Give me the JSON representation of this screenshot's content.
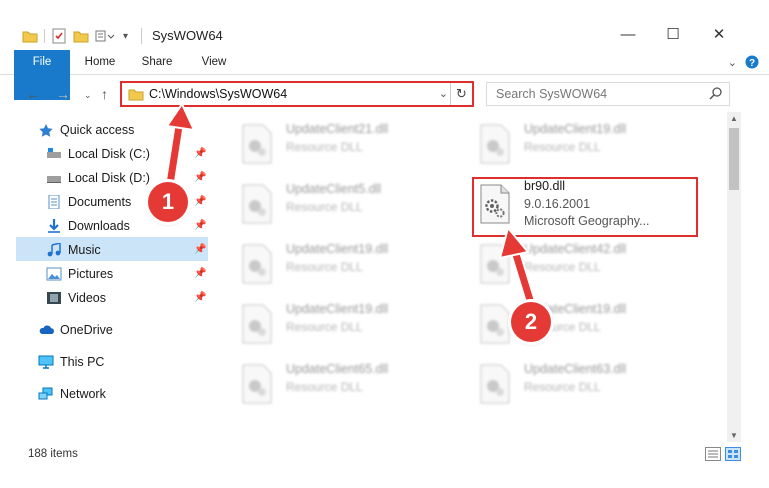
{
  "window": {
    "title": "SysWOW64",
    "controls": {
      "minimize": "—",
      "maximize": "☐",
      "close": "✕"
    }
  },
  "ribbon": {
    "tabs": [
      "File",
      "Home",
      "Share",
      "View"
    ],
    "expand_icon": "chevron-down-icon",
    "help_icon": "help-icon"
  },
  "address": {
    "path": "C:\\Windows\\SysWOW64",
    "search_placeholder": "Search SysWOW64"
  },
  "sidebar": {
    "items": [
      {
        "label": "Quick access",
        "icon": "star-icon",
        "pinned": false
      },
      {
        "label": "Local Disk (C:)",
        "icon": "drive-icon",
        "pinned": true
      },
      {
        "label": "Local Disk (D:)",
        "icon": "drive-icon",
        "pinned": true
      },
      {
        "label": "Documents",
        "icon": "documents-icon",
        "pinned": true
      },
      {
        "label": "Downloads",
        "icon": "downloads-icon",
        "pinned": true
      },
      {
        "label": "Music",
        "icon": "music-icon",
        "pinned": true
      },
      {
        "label": "Pictures",
        "icon": "pictures-icon",
        "pinned": true
      },
      {
        "label": "Videos",
        "icon": "videos-icon",
        "pinned": true
      },
      {
        "label": "OneDrive",
        "icon": "cloud-icon",
        "pinned": false
      },
      {
        "label": "This PC",
        "icon": "computer-icon",
        "pinned": false,
        "selected": true
      },
      {
        "label": "Network",
        "icon": "network-icon",
        "pinned": false
      }
    ]
  },
  "files": {
    "left": [
      {
        "name": "UpdateClient21.dll",
        "type": "Resource DLL"
      },
      {
        "name": "UpdateClient5.dll",
        "type": "Resource DLL"
      },
      {
        "name": "UpdateClient19.dll",
        "type": "Resource DLL"
      },
      {
        "name": "UpdateClient19.dll",
        "type": "Resource DLL"
      },
      {
        "name": "UpdateClient65.dll",
        "type": "Resource DLL"
      }
    ],
    "right": [
      {
        "name": "UpdateClient19.dll",
        "type": "Resource DLL"
      },
      {
        "name": "UpdateClient42.dll",
        "type": "Resource DLL"
      },
      {
        "name": "UpdateClient19.dll",
        "type": "Resource DLL"
      },
      {
        "name": "UpdateClient63.dll",
        "type": "Resource DLL"
      }
    ],
    "focus": {
      "name": "br90.dll",
      "version": "9.0.16.2001",
      "description": "Microsoft Geography..."
    }
  },
  "annotations": {
    "step1": "1",
    "step2": "2",
    "color": "#e53935"
  },
  "status": {
    "count": "188 items"
  },
  "colors": {
    "accent": "#1979ca",
    "selection": "#cce4f7",
    "highlight_border": "#e02e2e"
  }
}
